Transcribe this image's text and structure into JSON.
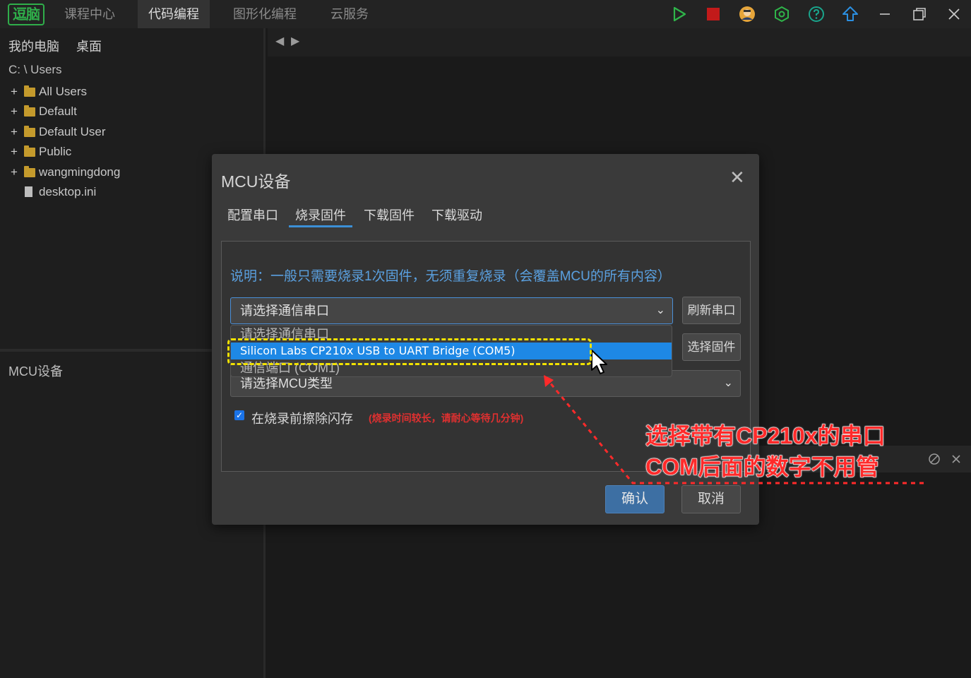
{
  "app": {
    "logo": "逗脑",
    "tabs": [
      {
        "label": "课程中心"
      },
      {
        "label": "代码编程",
        "active": true
      },
      {
        "label": "图形化编程"
      },
      {
        "label": "云服务"
      }
    ],
    "toolbar_icons": [
      "run-icon",
      "stop-icon",
      "user-avatar-icon",
      "settings-hex-icon",
      "help-icon",
      "upload-icon",
      "minimize-icon",
      "restore-icon",
      "close-icon"
    ]
  },
  "file_browser": {
    "locations": [
      "我的电脑",
      "桌面"
    ],
    "path": "C: \\ Users",
    "items": [
      {
        "name": "All Users",
        "type": "folder"
      },
      {
        "name": "Default",
        "type": "folder"
      },
      {
        "name": "Default User",
        "type": "folder"
      },
      {
        "name": "Public",
        "type": "folder"
      },
      {
        "name": "wangmingdong",
        "type": "folder"
      },
      {
        "name": "desktop.ini",
        "type": "file"
      }
    ],
    "bottom_panel_title": "MCU设备"
  },
  "dialog": {
    "title": "MCU设备",
    "tabs": [
      "配置串口",
      "烧录固件",
      "下载固件",
      "下载驱动"
    ],
    "active_tab": "烧录固件",
    "note": "说明：一般只需要烧录1次固件，无须重复烧录（会覆盖MCU的所有内容）",
    "port_select": {
      "value": "请选择通信串口",
      "options": [
        "请选择通信串口",
        "Silicon Labs CP210x USB to UART Bridge (COM5)",
        "通信端口 (COM1)"
      ],
      "highlighted": "Silicon Labs CP210x USB to UART Bridge (COM5)"
    },
    "refresh_button": "刷新串口",
    "firmware_button": "选择固件",
    "mcu_type_select": "请选择MCU类型",
    "erase_checkbox": {
      "label": "在烧录前擦除闪存",
      "checked": true,
      "note": "(烧录时间较长，请耐心等待几分钟)"
    },
    "confirm": "确认",
    "cancel": "取消"
  },
  "annotation": {
    "line1": "选择带有CP210x的串口",
    "line2": "COM后面的数字不用管"
  },
  "colors": {
    "accent": "#1e88e5",
    "annotation_red": "#ff2a2a",
    "highlight_yellow": "#f2e200",
    "brand_green": "#2fae4a"
  }
}
